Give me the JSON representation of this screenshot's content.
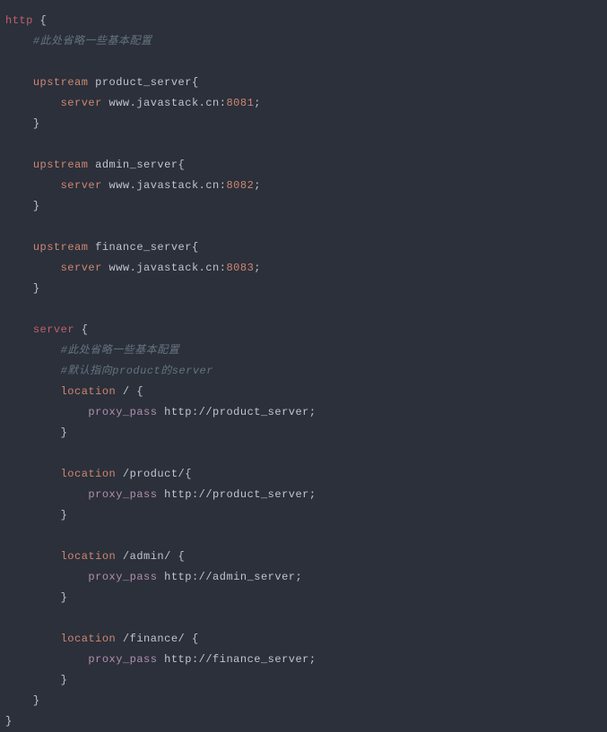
{
  "code": {
    "http_kw": "http",
    "brace_open": "{",
    "brace_close": "}",
    "comment_basic": "#此处省略一些基本配置",
    "upstream_kw": "upstream",
    "server_directive": "server",
    "server_block_kw": "server",
    "location_kw": "location",
    "proxy_pass_kw": "proxy_pass",
    "semi": ";",
    "upstreams": {
      "product": {
        "name": "product_server",
        "host_prefix": "www.",
        "host_mid": "javastack.",
        "host_suffix": "cn:",
        "port": "8081"
      },
      "admin": {
        "name": "admin_server",
        "host_prefix": "www.",
        "host_mid": "javastack.",
        "host_suffix": "cn:",
        "port": "8082"
      },
      "finance": {
        "name": "finance_server",
        "host_prefix": "www.",
        "host_mid": "javastack.",
        "host_suffix": "cn:",
        "port": "8083"
      }
    },
    "server_block": {
      "comment_basic": "#此处省略一些基本配置",
      "comment_default": "#默认指向product的server",
      "locations": {
        "root": {
          "path": "/ ",
          "pass_prefix": "http:",
          "pass_rest": "//product_server;"
        },
        "product": {
          "path": "/product/",
          "pass_prefix": "http:",
          "pass_rest": "//product_server;"
        },
        "admin": {
          "path": "/admin/ ",
          "pass_prefix": "http:",
          "pass_rest": "//admin_server;"
        },
        "finance": {
          "path": "/finance/ ",
          "pass_prefix": "http:",
          "pass_rest": "//finance_server;"
        }
      }
    }
  }
}
